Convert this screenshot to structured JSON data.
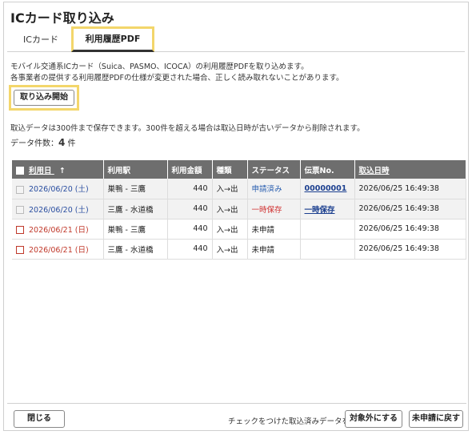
{
  "title": "ICカード取り込み",
  "tabs": [
    {
      "label": "ICカード"
    },
    {
      "label": "利用履歴PDF"
    }
  ],
  "description": {
    "line1": "モバイル交通系ICカード（Suica、PASMO、ICOCA）の利用履歴PDFを取り込めます。",
    "line2": "各事業者の提供する利用履歴PDFの仕様が変更された場合、正しく読み取れないことがあります。"
  },
  "import_button": "取り込み開始",
  "storage_note": "取込データは300件まで保存できます。300件を超える場合は取込日時が古いデータから削除されます。",
  "count": {
    "label": "データ件数：",
    "value": "4",
    "unit": "件"
  },
  "table": {
    "headers": {
      "date": "利用日",
      "sort_icon": "↑",
      "station": "利用駅",
      "amount": "利用金額",
      "type": "種類",
      "status": "ステータス",
      "slip": "伝票No.",
      "imported": "取込日時"
    },
    "rows": [
      {
        "date": "2026/06/20 (土)",
        "station": "巣鴨 - 三鷹",
        "amount": "440",
        "type": "入→出",
        "status": "申請済み",
        "slip": "00000001",
        "imported": "2026/06/25 16:49:38"
      },
      {
        "date": "2026/06/20 (土)",
        "station": "三鷹 - 水道橋",
        "amount": "440",
        "type": "入→出",
        "status": "一時保存",
        "slip": "一時保存",
        "imported": "2026/06/25 16:49:38"
      },
      {
        "date": "2026/06/21 (日)",
        "station": "巣鴨 - 三鷹",
        "amount": "440",
        "type": "入→出",
        "status": "未申請",
        "slip": "",
        "imported": "2026/06/25 16:49:38"
      },
      {
        "date": "2026/06/21 (日)",
        "station": "三鷹 - 水道橋",
        "amount": "440",
        "type": "入→出",
        "status": "未申請",
        "slip": "",
        "imported": "2026/06/25 16:49:38"
      }
    ]
  },
  "footer": {
    "close": "閉じる",
    "text": "チェックをつけた取込済みデータを",
    "exclude": "対象外にする",
    "revert": "未申請に戻す"
  },
  "colors": {
    "highlight": "#f3d66b",
    "header_bg": "#6e6e6e",
    "applied": "#2a5fb0",
    "temp_saved": "#d03030",
    "weekend_red": "#c0392b"
  }
}
